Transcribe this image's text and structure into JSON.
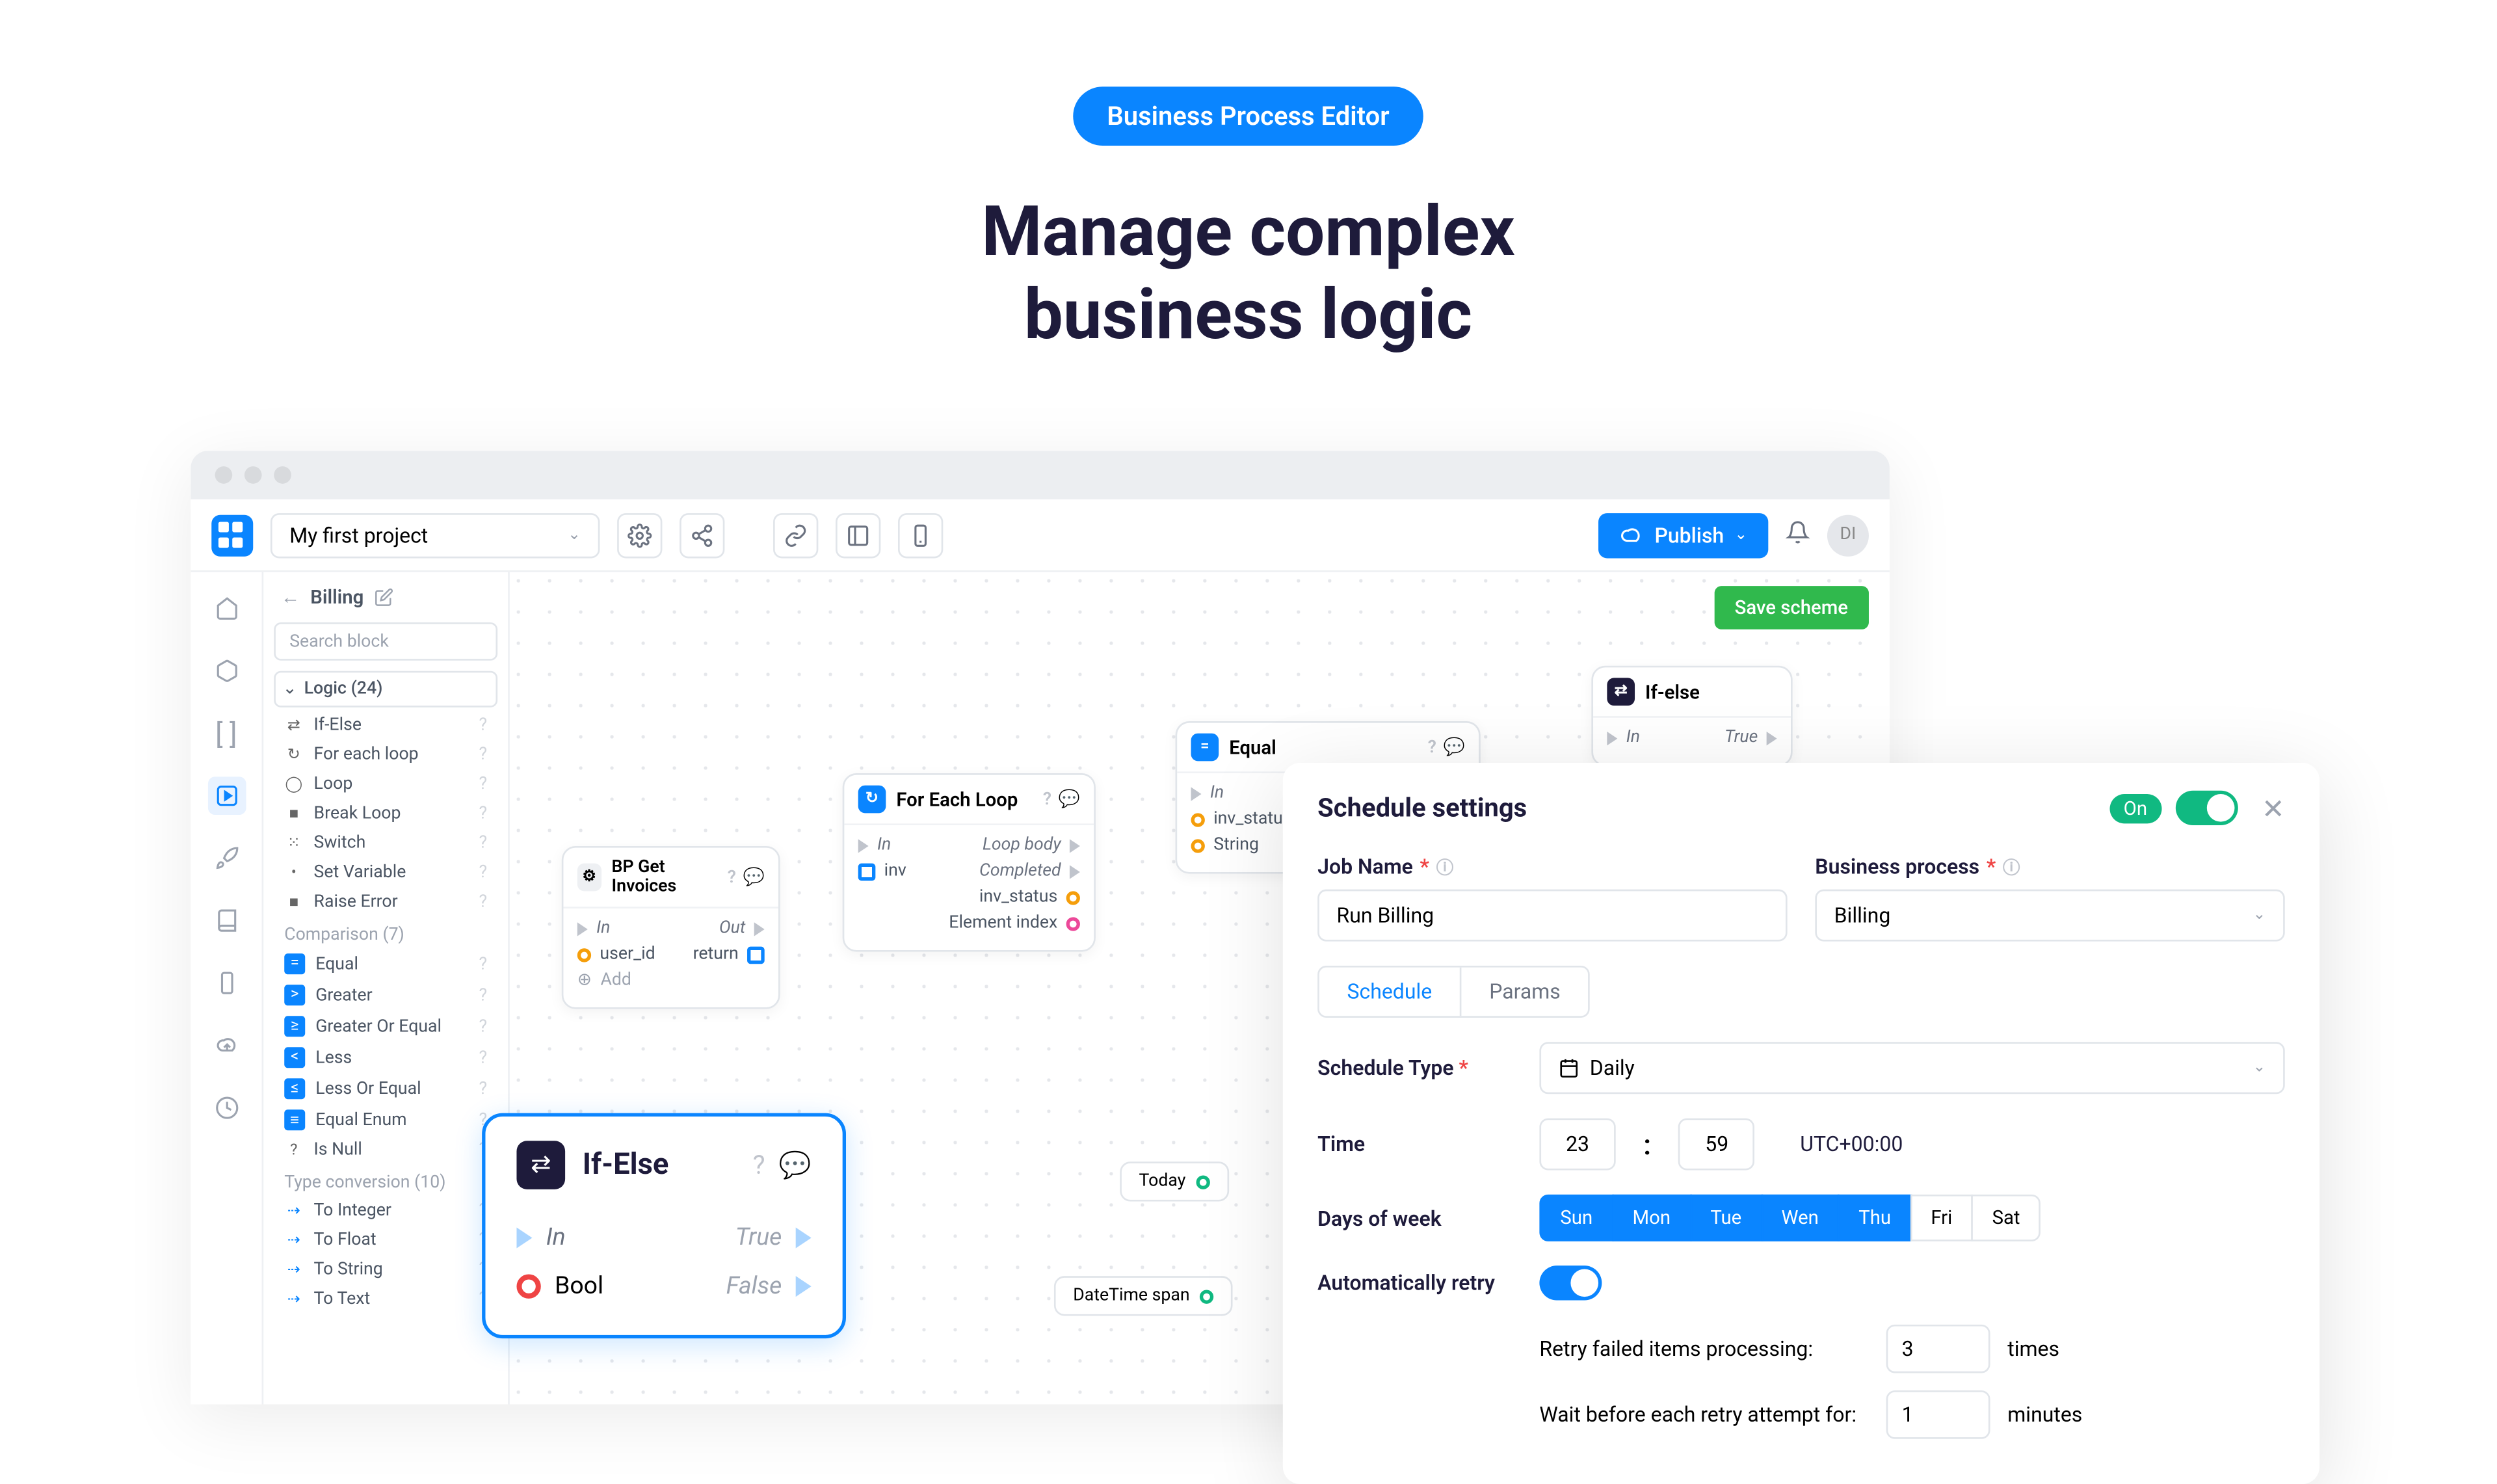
{
  "hero": {
    "pill": "Business Process Editor",
    "title_l1": "Manage complex",
    "title_l2": "business logic"
  },
  "topbar": {
    "project": "My first project",
    "publish": "Publish",
    "avatar": "DI"
  },
  "crumb": "Billing",
  "search_placeholder": "Search block",
  "save": "Save scheme",
  "cat_logic": "Logic (24)",
  "logic_items": [
    "If-Else",
    "For each loop",
    "Loop",
    "Break Loop",
    "Switch",
    "Set Variable",
    "Raise Error"
  ],
  "cat_comp": "Comparison (7)",
  "comp_items": [
    "Equal",
    "Greater",
    "Greater Or Equal",
    "Less",
    "Less Or Equal",
    "Equal Enum",
    "Is Null"
  ],
  "cat_conv": "Type conversion (10)",
  "conv_items": [
    "To Integer",
    "To Float",
    "To String",
    "To Text"
  ],
  "node_getinv": {
    "title": "BP Get Invoices",
    "in": "In",
    "out": "Out",
    "user_id": "user_id",
    "return": "return",
    "add": "Add"
  },
  "node_foreach": {
    "title": "For Each Loop",
    "in": "In",
    "loopbody": "Loop body",
    "inv": "inv",
    "completed": "Completed",
    "inv_status": "inv_status",
    "element_index": "Element index"
  },
  "node_equal": {
    "title": "Equal",
    "in": "In",
    "inv_status": "inv_statu",
    "string": "String"
  },
  "node_ifelse_small": {
    "title": "If-else",
    "in": "In",
    "true": "True"
  },
  "chip_today": "Today",
  "chip_dtspan": "DateTime span",
  "big": {
    "title": "If-Else",
    "in": "In",
    "true": "True",
    "bool": "Bool",
    "false": "False"
  },
  "panel": {
    "title": "Schedule settings",
    "on": "On",
    "job_label": "Job Name",
    "job_value": "Run Billing",
    "bp_label": "Business process",
    "bp_value": "Billing",
    "tab_schedule": "Schedule",
    "tab_params": "Params",
    "sched_type_label": "Schedule Type",
    "sched_type_value": "Daily",
    "time_label": "Time",
    "time_h": "23",
    "time_m": "59",
    "tz": "UTC+00:00",
    "dow_label": "Days of week",
    "days": [
      "Sun",
      "Mon",
      "Tue",
      "Wen",
      "Thu",
      "Fri",
      "Sat"
    ],
    "auto_retry": "Automatically retry",
    "retry_text": "Retry failed items processing:",
    "retry_n": "3",
    "times": "times",
    "wait_text": "Wait before each retry attempt for:",
    "wait_n": "1",
    "minutes": "minutes"
  }
}
